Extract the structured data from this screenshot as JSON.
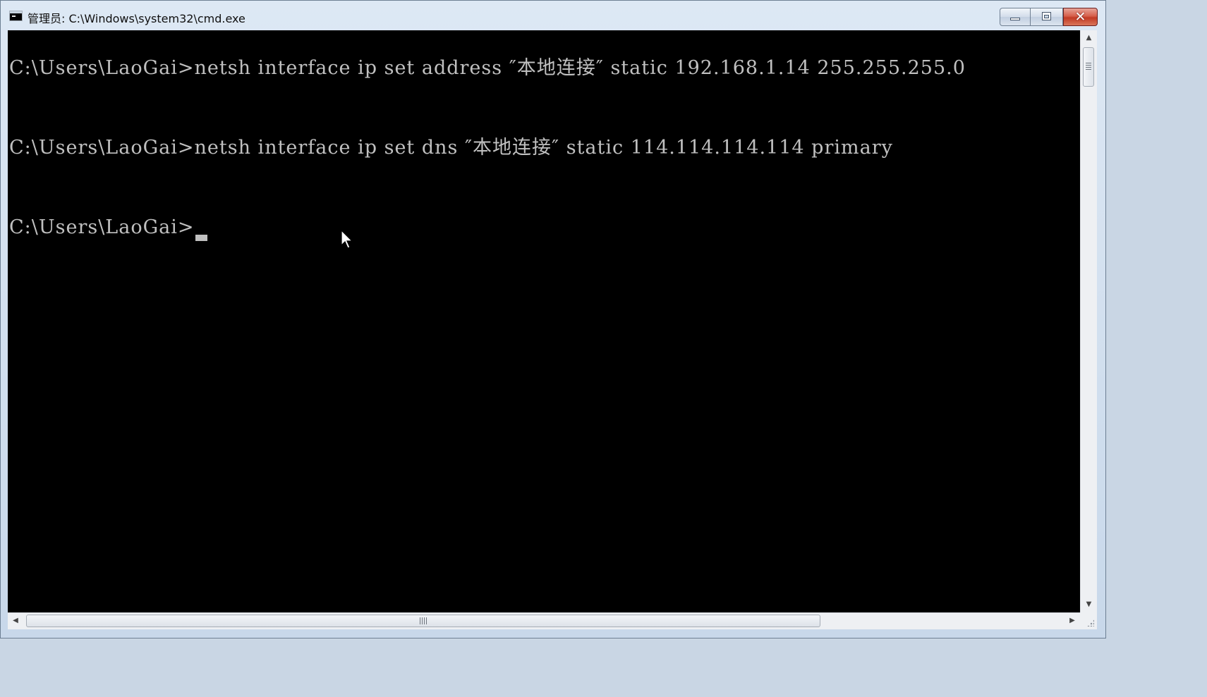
{
  "window": {
    "title": "管理员: C:\\Windows\\system32\\cmd.exe",
    "icons": {
      "app": "cmd-console-icon",
      "minimize": "minimize-icon",
      "maximize": "maximize-icon",
      "close": "close-icon",
      "close_glyph": "✕"
    }
  },
  "console": {
    "lines": [
      "C:\\Users\\LaoGai>netsh interface ip set address ″本地连接″ static 192.168.1.14 255.255.255.0",
      "C:\\Users\\LaoGai>netsh interface ip set dns ″本地连接″ static 114.114.114.114 primary",
      "C:\\Users\\LaoGai>"
    ],
    "text_color": "#c0c0c0",
    "background_color": "#000000"
  },
  "scrollbars": {
    "up_arrow": "▲",
    "down_arrow": "▼",
    "left_arrow": "◀",
    "right_arrow": "▶"
  }
}
